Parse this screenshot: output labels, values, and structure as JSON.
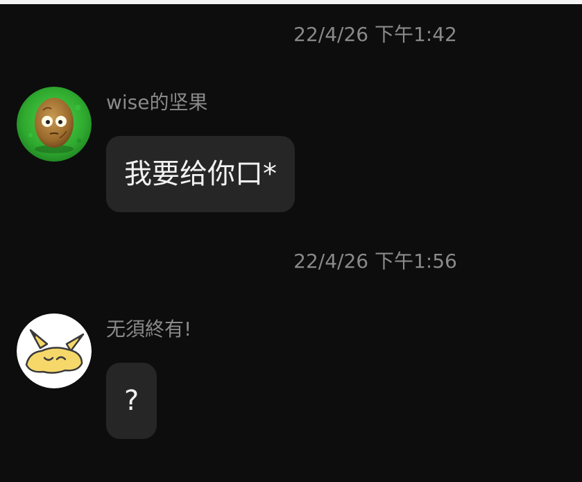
{
  "messages": [
    {
      "timestamp": "22/4/26 下午1:42",
      "sender": "wise的坚果",
      "avatar_icon": "wall-nut-avatar",
      "text": "我要给你口*"
    },
    {
      "timestamp": "22/4/26 下午1:56",
      "sender": "无須終有!",
      "avatar_icon": "pikachu-avatar",
      "text": "?"
    }
  ],
  "colors": {
    "background": "#0d0d0d",
    "bubble": "#262626",
    "meta_text": "#8a8a8a",
    "message_text": "#f2f2f2"
  }
}
